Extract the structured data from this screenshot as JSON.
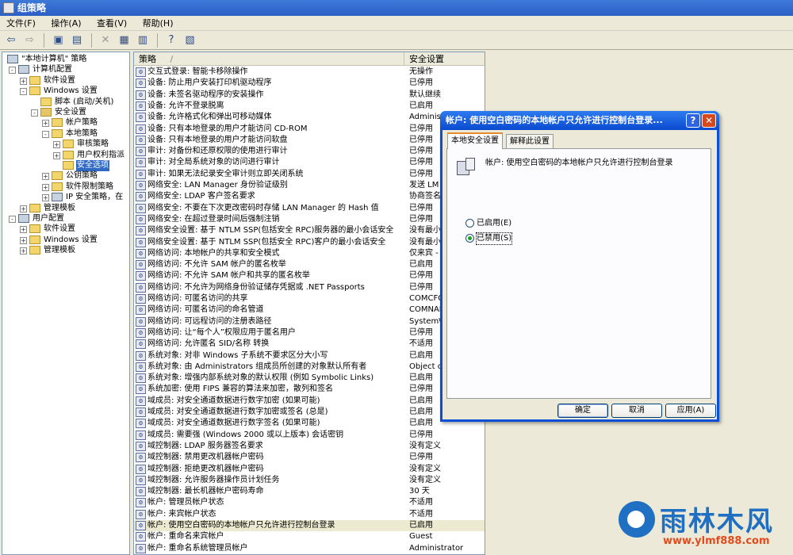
{
  "window": {
    "title": "组策略"
  },
  "menu": [
    "文件(F)",
    "操作(A)",
    "查看(V)",
    "帮助(H)"
  ],
  "toolbar": {
    "icons": [
      "back-icon",
      "forward-icon",
      "up-folder-icon",
      "show-tree-icon",
      "delete-icon",
      "properties-icon",
      "export-list-icon",
      "help-icon",
      "console-icon"
    ]
  },
  "tree": [
    {
      "label": "\"本地计算机\" 策略",
      "level": 0,
      "exp": "",
      "icon": "comp"
    },
    {
      "label": "计算机配置",
      "level": 1,
      "exp": "-",
      "icon": "comp"
    },
    {
      "label": "软件设置",
      "level": 2,
      "exp": "+",
      "icon": "folder"
    },
    {
      "label": "Windows 设置",
      "level": 2,
      "exp": "-",
      "icon": "folder"
    },
    {
      "label": "脚本 (启动/关机)",
      "level": 3,
      "exp": "",
      "icon": "folder"
    },
    {
      "label": "安全设置",
      "level": 3,
      "exp": "-",
      "icon": "lock"
    },
    {
      "label": "帐户策略",
      "level": 4,
      "exp": "+",
      "icon": "folder"
    },
    {
      "label": "本地策略",
      "level": 4,
      "exp": "-",
      "icon": "folder"
    },
    {
      "label": "审核策略",
      "level": 5,
      "exp": "+",
      "icon": "folder"
    },
    {
      "label": "用户权利指派",
      "level": 5,
      "exp": "+",
      "icon": "folder"
    },
    {
      "label": "安全选项",
      "level": 5,
      "exp": "",
      "icon": "folder",
      "selected": true
    },
    {
      "label": "公钥策略",
      "level": 4,
      "exp": "+",
      "icon": "folder"
    },
    {
      "label": "软件限制策略",
      "level": 4,
      "exp": "+",
      "icon": "folder"
    },
    {
      "label": "IP 安全策略，在",
      "level": 4,
      "exp": "+",
      "icon": "comp"
    },
    {
      "label": "管理模板",
      "level": 2,
      "exp": "+",
      "icon": "folder"
    },
    {
      "label": "用户配置",
      "level": 1,
      "exp": "-",
      "icon": "comp"
    },
    {
      "label": "软件设置",
      "level": 2,
      "exp": "+",
      "icon": "folder"
    },
    {
      "label": "Windows 设置",
      "level": 2,
      "exp": "+",
      "icon": "folder"
    },
    {
      "label": "管理模板",
      "level": 2,
      "exp": "+",
      "icon": "folder"
    }
  ],
  "list": {
    "headers": {
      "policy": "策略",
      "setting": "安全设置",
      "sort_indicator": "/"
    },
    "rows": [
      {
        "p": "交互式登录: 智能卡移除操作",
        "s": "无操作"
      },
      {
        "p": "设备: 防止用户安装打印机驱动程序",
        "s": "已停用"
      },
      {
        "p": "设备: 未签名驱动程序的安装操作",
        "s": "默认继续"
      },
      {
        "p": "设备: 允许不登录脱离",
        "s": "已启用"
      },
      {
        "p": "设备: 允许格式化和弹出可移动媒体",
        "s": "Administ"
      },
      {
        "p": "设备: 只有本地登录的用户才能访问 CD-ROM",
        "s": "已停用"
      },
      {
        "p": "设备: 只有本地登录的用户才能访问软盘",
        "s": "已停用"
      },
      {
        "p": "审计: 对备份和还原权限的使用进行审计",
        "s": "已停用"
      },
      {
        "p": "审计: 对全局系统对象的访问进行审计",
        "s": "已停用"
      },
      {
        "p": "审计: 如果无法纪录安全审计则立即关闭系统",
        "s": "已停用"
      },
      {
        "p": "网络安全: LAN Manager 身份验证级别",
        "s": "发送 LM"
      },
      {
        "p": "网络安全: LDAP 客户签名要求",
        "s": "协商签名"
      },
      {
        "p": "网络安全: 不要在下次更改密码时存储 LAN Manager 的 Hash 值",
        "s": "已停用"
      },
      {
        "p": "网络安全: 在超过登录时间后强制注销",
        "s": "已停用"
      },
      {
        "p": "网络安全设置: 基于 NTLM SSP(包括安全 RPC)服务器的最小会话安全",
        "s": "没有最小"
      },
      {
        "p": "网络安全设置: 基于 NTLM SSP(包括安全 RPC)客户的最小会话安全",
        "s": "没有最小"
      },
      {
        "p": "网络访问: 本地帐户的共享和安全模式",
        "s": "仅来宾 -"
      },
      {
        "p": "网络访问: 不允许 SAM 帐户的匿名枚举",
        "s": "已启用"
      },
      {
        "p": "网络访问: 不允许 SAM 帐户和共享的匿名枚举",
        "s": "已停用"
      },
      {
        "p": "网络访问: 不允许为网络身份验证储存凭据或 .NET Passports",
        "s": "已停用"
      },
      {
        "p": "网络访问: 可匿名访问的共享",
        "s": "COMCFG,D"
      },
      {
        "p": "网络访问: 可匿名访问的命名管道",
        "s": "COMNAP,C"
      },
      {
        "p": "网络访问: 可远程访问的注册表路径",
        "s": "System\\C"
      },
      {
        "p": "网络访问: 让“每个人”权限应用于匿名用户",
        "s": "已停用"
      },
      {
        "p": "网络访问: 允许匿名 SID/名称 转换",
        "s": "不适用"
      },
      {
        "p": "系统对象: 对非 Windows 子系统不要求区分大小写",
        "s": "已启用"
      },
      {
        "p": "系统对象: 由 Administrators 组成员所创建的对象默认所有者",
        "s": "Object c"
      },
      {
        "p": "系统对象: 增强内部系统对象的默认权限 (例如 Symbolic Links)",
        "s": "已启用"
      },
      {
        "p": "系统加密: 使用 FIPS 兼容的算法来加密，散列和签名",
        "s": "已停用"
      },
      {
        "p": "域成员: 对安全通道数据进行数字加密 (如果可能)",
        "s": "已启用"
      },
      {
        "p": "域成员: 对安全通道数据进行数字加密或签名 (总是)",
        "s": "已启用"
      },
      {
        "p": "域成员: 对安全通道数据进行数字签名 (如果可能)",
        "s": "已启用"
      },
      {
        "p": "域成员: 需要强 (Windows 2000 或以上版本) 会话密钥",
        "s": "已停用"
      },
      {
        "p": "域控制器: LDAP 服务器签名要求",
        "s": "没有定义"
      },
      {
        "p": "域控制器: 禁用更改机器帐户密码",
        "s": "已停用"
      },
      {
        "p": "域控制器: 拒绝更改机器帐户密码",
        "s": "没有定义"
      },
      {
        "p": "域控制器: 允许服务器操作员计划任务",
        "s": "没有定义"
      },
      {
        "p": "域控制器: 最长机器帐户密码寿命",
        "s": "30 天"
      },
      {
        "p": "帐户: 管理员帐户状态",
        "s": "不适用"
      },
      {
        "p": "帐户: 来宾帐户状态",
        "s": "不适用"
      },
      {
        "p": "帐户: 使用空白密码的本地帐户只允许进行控制台登录",
        "s": "已启用",
        "highlight": true
      },
      {
        "p": "帐户: 重命名来宾帐户",
        "s": "Guest"
      },
      {
        "p": "帐户: 重命名系统管理员帐户",
        "s": "Administrator"
      }
    ]
  },
  "dialog": {
    "title": "帐户: 使用空白密码的本地帐户只允许进行控制台登录...",
    "help_glyph": "?",
    "close_glyph": "✕",
    "tabs": [
      "本地安全设置",
      "解释此设置"
    ],
    "policy_name": "帐户: 使用空白密码的本地帐户只允许进行控制台登录",
    "options": [
      "已启用(E)",
      "已禁用(S)"
    ],
    "selected_option": 1,
    "buttons": {
      "ok": "确定",
      "cancel": "取消",
      "apply": "应用(A)"
    }
  },
  "watermark": {
    "brand": "雨林木风",
    "url": "www.ylmf888.com"
  }
}
